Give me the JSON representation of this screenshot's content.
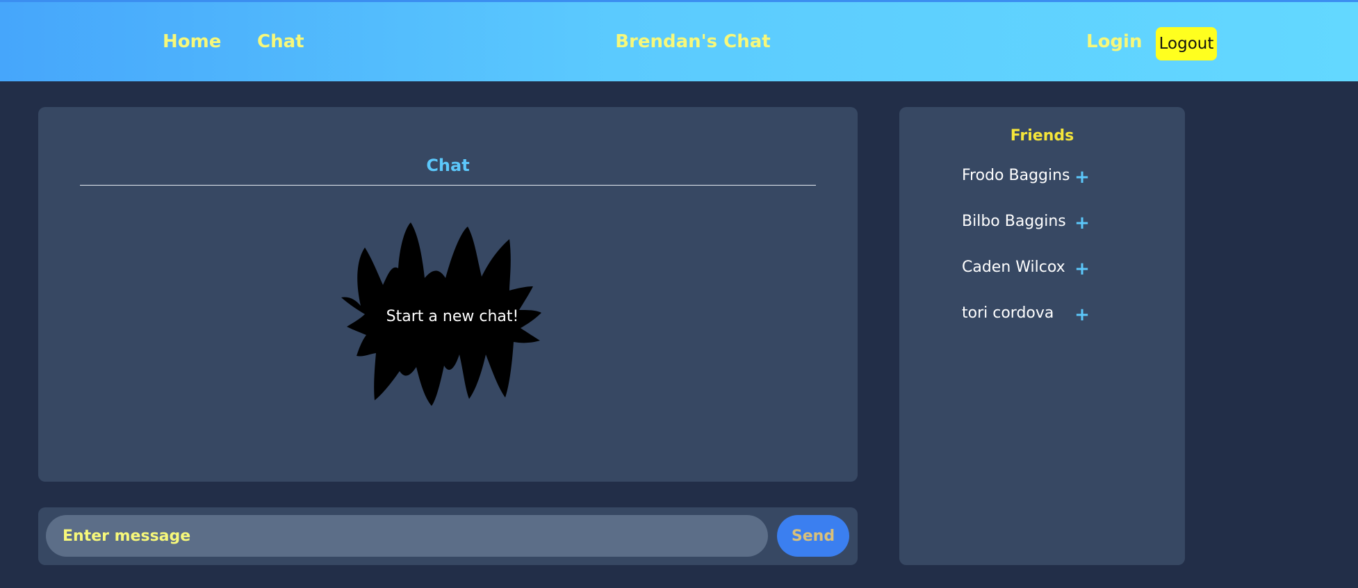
{
  "nav": {
    "home_label": "Home",
    "chat_label": "Chat",
    "brand": "Brendan's Chat",
    "login_label": "Login",
    "logout_label": "Logout"
  },
  "chat": {
    "title": "Chat",
    "empty_state": "Start a new chat!"
  },
  "composer": {
    "placeholder": "Enter message",
    "send_label": "Send"
  },
  "friends": {
    "title": "Friends",
    "add_symbol": "+",
    "items": [
      {
        "name": "Frodo Baggins"
      },
      {
        "name": "Bilbo Baggins"
      },
      {
        "name": "Caden Wilcox"
      },
      {
        "name": "tori cordova"
      }
    ]
  },
  "colors": {
    "page_bg": "#222e48",
    "panel_bg": "#374863",
    "nav_text": "#f7f87a",
    "accent_blue": "#5cc8fb",
    "logout_bg": "#ffff1f",
    "send_bg": "#3b7ff0"
  },
  "icons": {
    "empty_state_graphic": "spiky-burst",
    "add_friend": "plus-icon"
  }
}
